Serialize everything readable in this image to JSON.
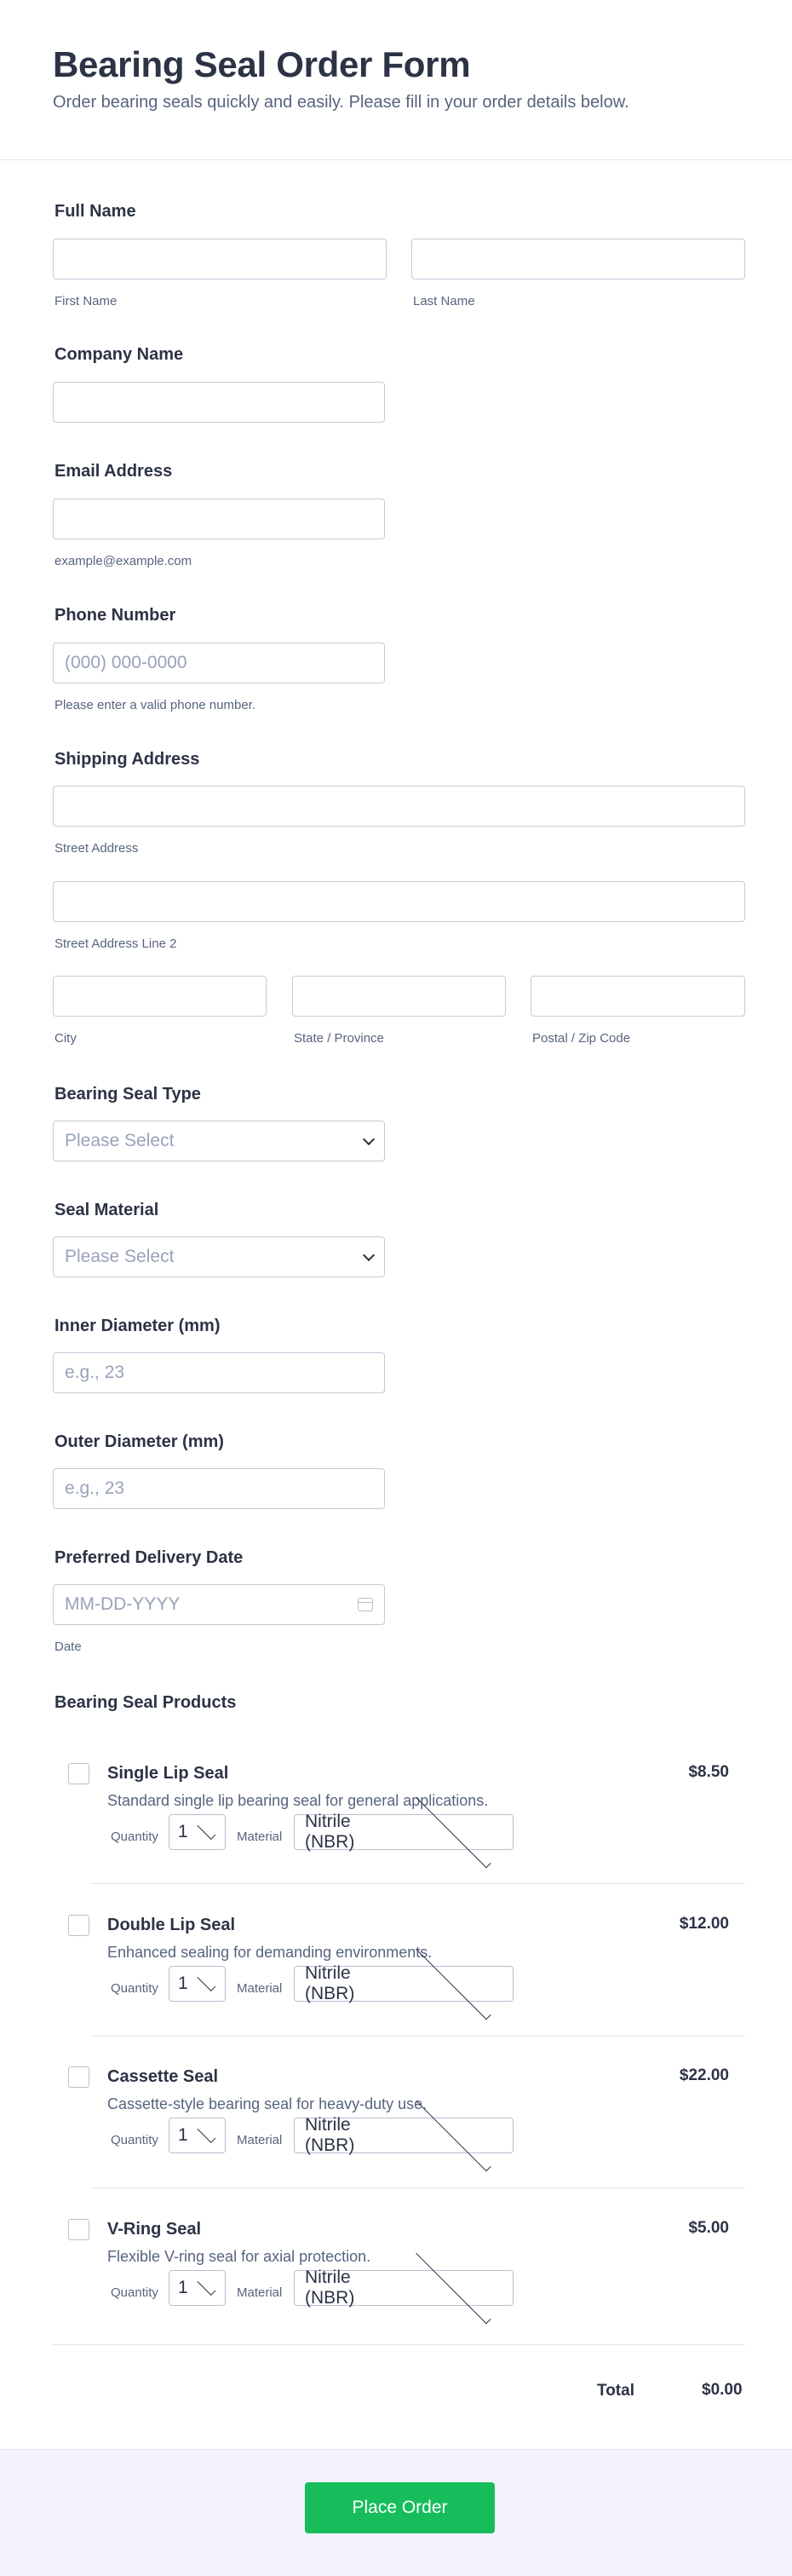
{
  "header": {
    "title": "Bearing Seal Order Form",
    "subtitle": "Order bearing seals quickly and easily. Please fill in your order details below."
  },
  "full_name": {
    "label": "Full Name",
    "first_sub": "First Name",
    "last_sub": "Last Name",
    "first_value": "",
    "last_value": ""
  },
  "company": {
    "label": "Company Name",
    "value": ""
  },
  "email": {
    "label": "Email Address",
    "value": "",
    "sub": "example@example.com"
  },
  "phone": {
    "label": "Phone Number",
    "placeholder": "(000) 000-0000",
    "sub": "Please enter a valid phone number."
  },
  "address": {
    "label": "Shipping Address",
    "street_sub": "Street Address",
    "street2_sub": "Street Address Line 2",
    "city_sub": "City",
    "state_sub": "State / Province",
    "zip_sub": "Postal / Zip Code"
  },
  "seal_type": {
    "label": "Bearing Seal Type",
    "selected": "Please Select"
  },
  "seal_material": {
    "label": "Seal Material",
    "selected": "Please Select"
  },
  "inner_diameter": {
    "label": "Inner Diameter (mm)",
    "placeholder": "e.g., 23"
  },
  "outer_diameter": {
    "label": "Outer Diameter (mm)",
    "placeholder": "e.g., 23"
  },
  "delivery_date": {
    "label": "Preferred Delivery Date",
    "placeholder": "MM-DD-YYYY",
    "sub": "Date"
  },
  "products": {
    "label": "Bearing Seal Products",
    "quantity_label": "Quantity",
    "material_label": "Material",
    "items": [
      {
        "name": "Single Lip Seal",
        "price": "$8.50",
        "description": "Standard single lip bearing seal for general applications.",
        "quantity": "1",
        "material": "Nitrile (NBR)",
        "checked": false
      },
      {
        "name": "Double Lip Seal",
        "price": "$12.00",
        "description": "Enhanced sealing for demanding environments.",
        "quantity": "1",
        "material": "Nitrile (NBR)",
        "checked": false
      },
      {
        "name": "Cassette Seal",
        "price": "$22.00",
        "description": "Cassette-style bearing seal for heavy-duty use.",
        "quantity": "1",
        "material": "Nitrile (NBR)",
        "checked": false
      },
      {
        "name": "V-Ring Seal",
        "price": "$5.00",
        "description": "Flexible V-ring seal for axial protection.",
        "quantity": "1",
        "material": "Nitrile (NBR)",
        "checked": false
      }
    ],
    "total_label": "Total",
    "total_value": "$0.00"
  },
  "submit": {
    "label": "Place Order"
  },
  "colors": {
    "accent": "#18bd5b",
    "text": "#2c3345",
    "muted": "#57647e",
    "border": "#c3cad8",
    "footer_bg": "#f3f3fe"
  },
  "icons": {
    "dropdown": "chevron-down-icon",
    "date": "calendar-icon"
  }
}
